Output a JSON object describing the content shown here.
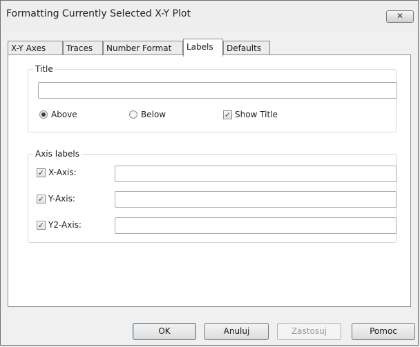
{
  "window": {
    "title": "Formatting Currently Selected X-Y Plot",
    "close_glyph": "✕"
  },
  "tabs": [
    {
      "label": "X-Y Axes",
      "active": false
    },
    {
      "label": "Traces",
      "active": false
    },
    {
      "label": "Number Format",
      "active": false
    },
    {
      "label": "Labels",
      "active": true
    },
    {
      "label": "Defaults",
      "active": false
    }
  ],
  "title_group": {
    "legend": "Title",
    "title_value": "",
    "position_options": [
      {
        "label": "Above",
        "checked": true
      },
      {
        "label": "Below",
        "checked": false
      }
    ],
    "show_title": {
      "label": "Show Title",
      "checked": true
    }
  },
  "axis_group": {
    "legend": "Axis labels",
    "axes": [
      {
        "label": "X-Axis:",
        "checked": true,
        "value": ""
      },
      {
        "label": "Y-Axis:",
        "checked": true,
        "value": ""
      },
      {
        "label": "Y2-Axis:",
        "checked": true,
        "value": ""
      }
    ]
  },
  "buttons": {
    "ok": "OK",
    "cancel": "Anuluj",
    "apply": "Zastosuj",
    "help": "Pomoc"
  },
  "icons": {
    "check_glyph": "✓"
  }
}
